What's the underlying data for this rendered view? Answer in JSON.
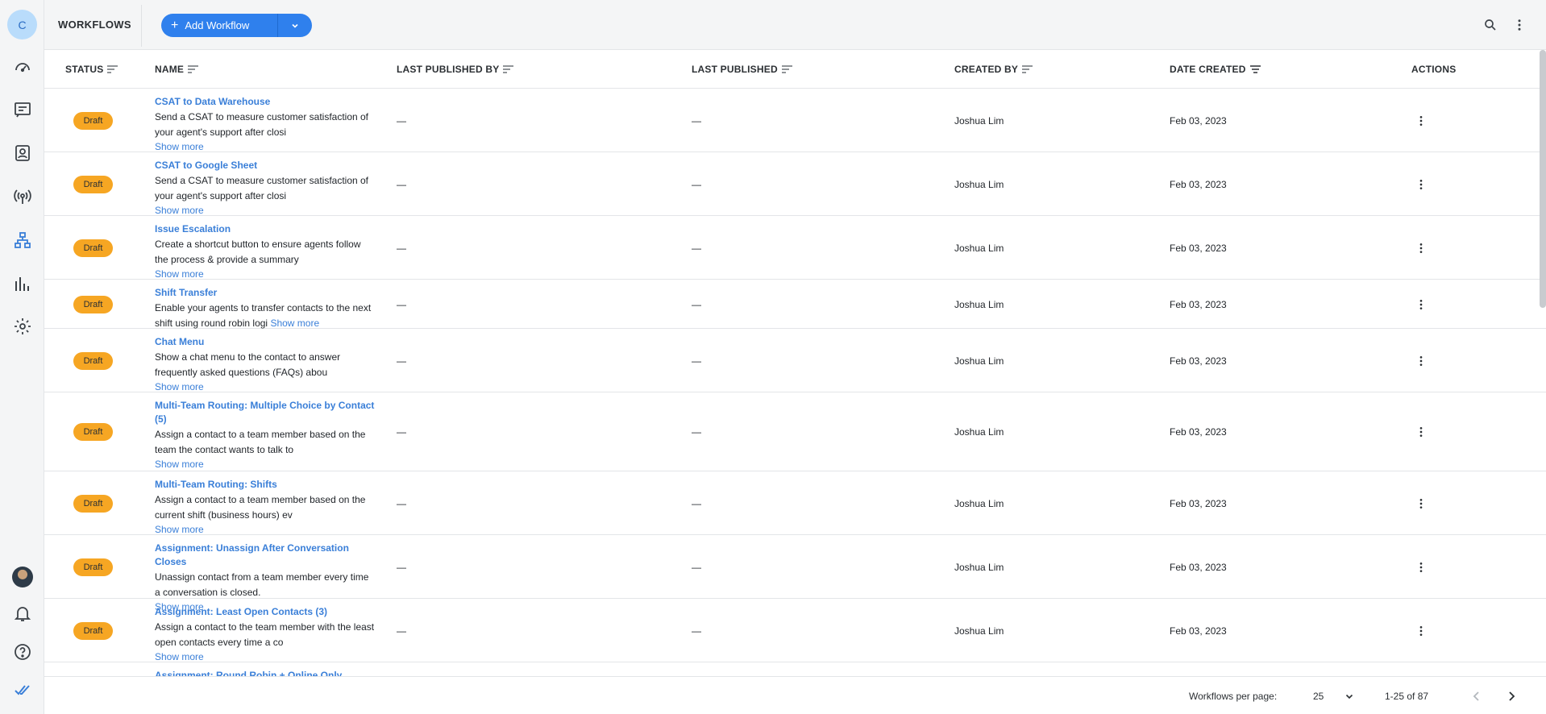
{
  "header": {
    "title": "WORKFLOWS",
    "add_button_label": "Add Workflow",
    "app_initial": "C"
  },
  "columns": {
    "status": "STATUS",
    "name": "NAME",
    "last_published_by": "LAST PUBLISHED BY",
    "last_published": "LAST PUBLISHED",
    "created_by": "CREATED BY",
    "date_created": "DATE CREATED",
    "actions": "ACTIONS"
  },
  "show_more_label": "Show more",
  "rows": [
    {
      "status": "Draft",
      "name": "CSAT to Data Warehouse",
      "desc": "Send a CSAT to measure customer satisfaction of your agent's support after closi",
      "last_published_by": "—",
      "last_published": "—",
      "created_by": "Joshua Lim",
      "date_created": "Feb 03, 2023"
    },
    {
      "status": "Draft",
      "name": "CSAT to Google Sheet",
      "desc": "Send a CSAT to measure customer satisfaction of your agent's support after closi",
      "last_published_by": "—",
      "last_published": "—",
      "created_by": "Joshua Lim",
      "date_created": "Feb 03, 2023"
    },
    {
      "status": "Draft",
      "name": "Issue Escalation",
      "desc": "Create a shortcut button to ensure agents follow the process & provide a summary",
      "last_published_by": "—",
      "last_published": "—",
      "created_by": "Joshua Lim",
      "date_created": "Feb 03, 2023"
    },
    {
      "status": "Draft",
      "name": "Shift Transfer",
      "desc": "Enable your agents to transfer contacts to the next shift using round robin logi",
      "last_published_by": "—",
      "last_published": "—",
      "created_by": "Joshua Lim",
      "date_created": "Feb 03, 2023"
    },
    {
      "status": "Draft",
      "name": "Chat Menu",
      "desc": "Show a chat menu to the contact to answer frequently asked questions (FAQs) abou",
      "last_published_by": "—",
      "last_published": "—",
      "created_by": "Joshua Lim",
      "date_created": "Feb 03, 2023"
    },
    {
      "status": "Draft",
      "name": "Multi-Team Routing: Multiple Choice by Contact (5)",
      "desc": "Assign a contact to a team member based on the team the contact wants to talk to",
      "last_published_by": "—",
      "last_published": "—",
      "created_by": "Joshua Lim",
      "date_created": "Feb 03, 2023"
    },
    {
      "status": "Draft",
      "name": "Multi-Team Routing: Shifts",
      "desc": "Assign a contact to a team member based on the current shift (business hours) ev",
      "last_published_by": "—",
      "last_published": "—",
      "created_by": "Joshua Lim",
      "date_created": "Feb 03, 2023"
    },
    {
      "status": "Draft",
      "name": "Assignment: Unassign After Conversation Closes",
      "desc": "Unassign contact from a team member every time a conversation is closed.",
      "last_published_by": "—",
      "last_published": "—",
      "created_by": "Joshua Lim",
      "date_created": "Feb 03, 2023"
    },
    {
      "status": "Draft",
      "name": "Assignment: Least Open Contacts (3)",
      "desc": "Assign a contact to the team member with the least open contacts every time a co",
      "last_published_by": "—",
      "last_published": "—",
      "created_by": "Joshua Lim",
      "date_created": "Feb 03, 2023"
    },
    {
      "status": "",
      "name": "Assignment: Round Robin + Online Only",
      "desc": "",
      "last_published_by": "",
      "last_published": "",
      "created_by": "",
      "date_created": ""
    }
  ],
  "footer": {
    "per_page_label": "Workflows per page:",
    "per_page_value": "25",
    "range": "1-25 of 87"
  },
  "colors": {
    "accent": "#2f80ed",
    "link": "#3a7fd8",
    "draft_badge": "#f6a623"
  }
}
